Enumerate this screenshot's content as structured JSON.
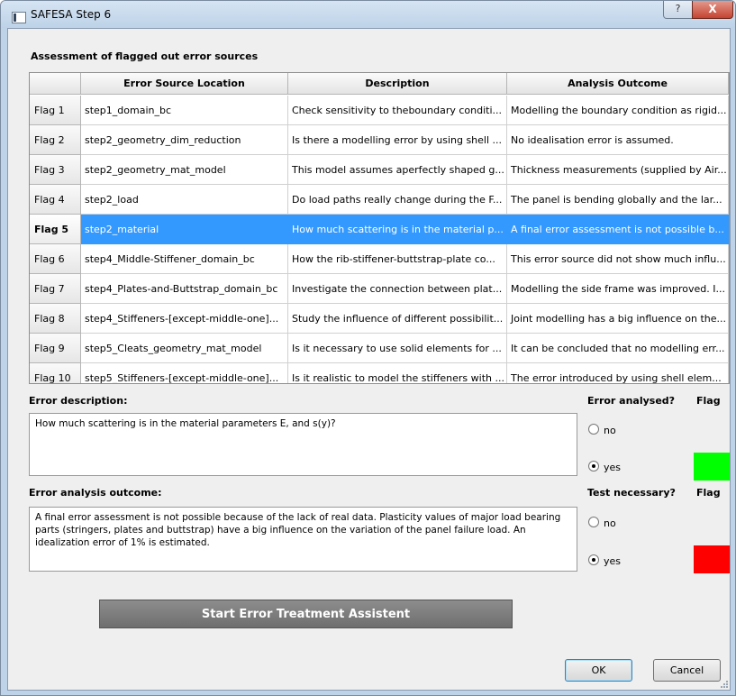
{
  "window": {
    "title": "SAFESA Step 6",
    "help_glyph": "?",
    "close_glyph": "X"
  },
  "assessment": {
    "section_title": "Assessment of flagged out error sources",
    "columns": [
      "Error Source Location",
      "Description",
      "Analysis Outcome"
    ],
    "selected_row": 4,
    "rows": [
      {
        "flag": "Flag 1",
        "location": "step1_domain_bc",
        "description": "Check sensitivity to theboundary conditi...",
        "outcome": "Modelling the boundary condition as rigid..."
      },
      {
        "flag": "Flag 2",
        "location": "step2_geometry_dim_reduction",
        "description": "Is there a modelling error by using shell ...",
        "outcome": "No idealisation error is assumed."
      },
      {
        "flag": "Flag 3",
        "location": "step2_geometry_mat_model",
        "description": "This model assumes aperfectly shaped g...",
        "outcome": "Thickness measurements (supplied by Air..."
      },
      {
        "flag": "Flag 4",
        "location": "step2_load",
        "description": "Do load paths really change during the F...",
        "outcome": "The panel is bending globally and the lar..."
      },
      {
        "flag": "Flag 5",
        "location": "step2_material",
        "description": "How much scattering is in the material p...",
        "outcome": "A final error assessment is not possible b..."
      },
      {
        "flag": "Flag 6",
        "location": "step4_Middle-Stiffener_domain_bc",
        "description": "How the rib-stiffener-buttstrap-plate co...",
        "outcome": "This error source did not show much influ..."
      },
      {
        "flag": "Flag 7",
        "location": "step4_Plates-and-Buttstrap_domain_bc",
        "description": "Investigate the connection between plat...",
        "outcome": "Modelling the side frame was improved. I..."
      },
      {
        "flag": "Flag 8",
        "location": "step4_Stiffeners-[except-middle-one]...",
        "description": "Study the influence of different possibilit...",
        "outcome": "Joint modelling has a big influence on the..."
      },
      {
        "flag": "Flag 9",
        "location": "step5_Cleats_geometry_mat_model",
        "description": "Is it necessary to use solid elements for ...",
        "outcome": "It can be concluded that no modelling err..."
      },
      {
        "flag": "Flag 10",
        "location": "step5_Stiffeners-[except-middle-one]...",
        "description": "Is it realistic to model the stiffeners with ...",
        "outcome": "The error introduced by using shell elem..."
      }
    ]
  },
  "error_description": {
    "label": "Error description:",
    "text": "How much scattering is in the material parameters E, and s(y)?",
    "question": "Error analysed?",
    "flag_label": "Flag",
    "option_no": "no",
    "option_yes": "yes",
    "selected": "yes",
    "flag_color": "#00ff00"
  },
  "error_outcome": {
    "label": "Error analysis outcome:",
    "text": "A final error assessment is not possible because of the lack of real data. Plasticity values of major load bearing parts (stringers, plates and buttstrap) have a big influence on the variation of the panel failure load. An idealization error of 1% is estimated.",
    "question": "Test necessary?",
    "flag_label": "Flag",
    "option_no": "no",
    "option_yes": "yes",
    "selected": "yes",
    "flag_color": "#ff0000"
  },
  "actions": {
    "start_label": "Start Error Treatment Assistent",
    "ok_label": "OK",
    "cancel_label": "Cancel"
  }
}
